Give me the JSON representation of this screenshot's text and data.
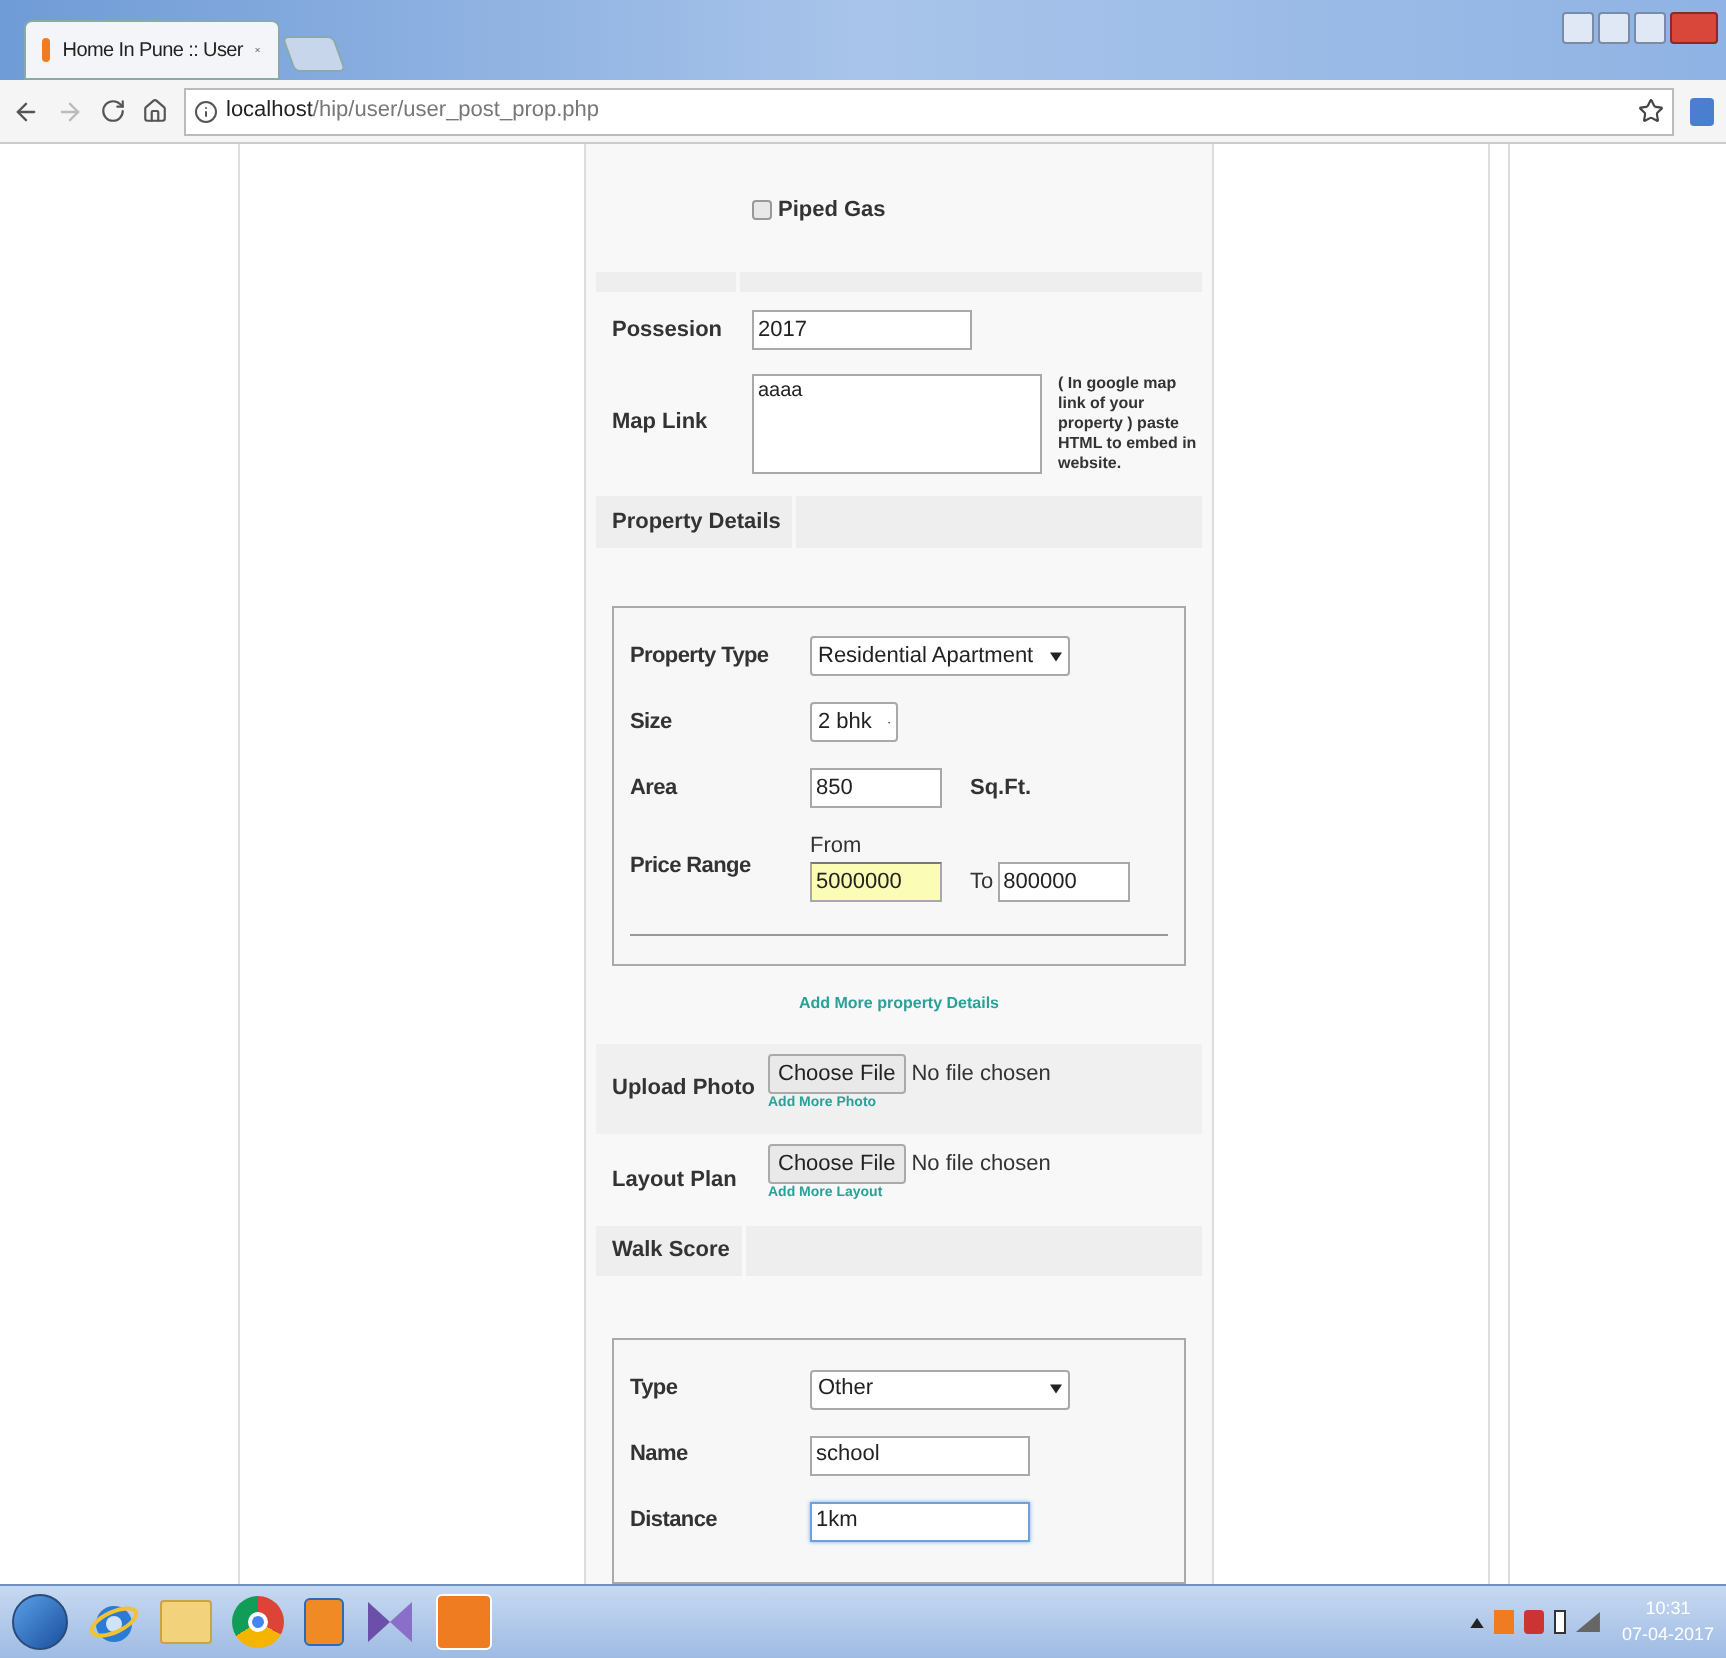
{
  "browser": {
    "tab_title": "Home In Pune :: User",
    "url_host": "localhost",
    "url_path": "/hip/user/user_post_prop.php"
  },
  "amenities": [
    {
      "label": "Piped Gas",
      "checked": false
    }
  ],
  "possession": {
    "label": "Possesion",
    "value": "2017"
  },
  "map_link": {
    "label": "Map Link",
    "value": "aaaa",
    "hint": "( In google map link of your property ) paste HTML to embed in website."
  },
  "property_details": {
    "heading": "Property Details",
    "add_more": "Add More property Details",
    "fields": [
      {
        "kind": "select",
        "label": "Property Type",
        "value": "Residential Apartment"
      },
      {
        "kind": "select",
        "label": "Size",
        "value": "2 bhk"
      },
      {
        "kind": "input",
        "label": "Area",
        "value": "850",
        "unit": "Sq.Ft."
      },
      {
        "kind": "range",
        "label": "Price Range",
        "from_label": "From",
        "from": "5000000",
        "autofilled": true,
        "to_label": "To",
        "to": "800000"
      }
    ]
  },
  "uploads": [
    {
      "label": "Upload Photo",
      "button": "Choose File",
      "status": "No file chosen",
      "add_more": "Add More Photo"
    },
    {
      "label": "Layout Plan",
      "button": "Choose File",
      "status": "No file chosen",
      "add_more": "Add More Layout"
    }
  ],
  "walk_score": {
    "heading": "Walk Score",
    "fields": [
      {
        "kind": "select",
        "label": "Type",
        "value": "Other",
        "focused": false
      },
      {
        "kind": "input",
        "label": "Name",
        "value": "school",
        "focused": false
      },
      {
        "kind": "input",
        "label": "Distance",
        "value": "1km",
        "focused": true
      }
    ]
  },
  "taskbar": {
    "time": "10:31",
    "date": "07-04-2017"
  }
}
